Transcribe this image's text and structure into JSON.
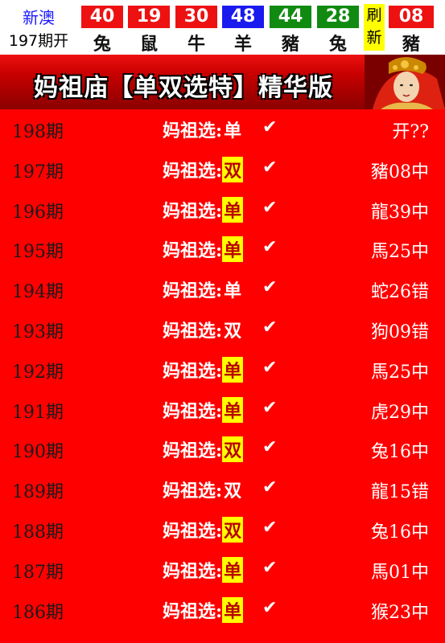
{
  "header": {
    "label_top": "新澳",
    "label_bottom": "197期开",
    "balls": [
      {
        "number": "40",
        "zodiac": "兔",
        "color": "#ee1111"
      },
      {
        "number": "19",
        "zodiac": "鼠",
        "color": "#ee1111"
      },
      {
        "number": "30",
        "zodiac": "牛",
        "color": "#ee1111"
      },
      {
        "number": "48",
        "zodiac": "羊",
        "color": "#1a1aee"
      },
      {
        "number": "44",
        "zodiac": "豬",
        "color": "#118a11"
      },
      {
        "number": "28",
        "zodiac": "兔",
        "color": "#118a11"
      }
    ],
    "refresh_chars": [
      "刷",
      "新"
    ],
    "special": {
      "number": "08",
      "zodiac": "豬",
      "color": "#ee1111"
    }
  },
  "banner": {
    "title": "妈祖庙【单双选特】精华版"
  },
  "rows": [
    {
      "period": "198期",
      "label": "妈祖选:",
      "value": "单",
      "highlight": false,
      "check": "✔",
      "result": "开??"
    },
    {
      "period": "197期",
      "label": "妈祖选:",
      "value": "双",
      "highlight": true,
      "check": "✔",
      "result": "豬08中"
    },
    {
      "period": "196期",
      "label": "妈祖选:",
      "value": "单",
      "highlight": true,
      "check": "✔",
      "result": "龍39中"
    },
    {
      "period": "195期",
      "label": "妈祖选:",
      "value": "单",
      "highlight": true,
      "check": "✔",
      "result": "馬25中"
    },
    {
      "period": "194期",
      "label": "妈祖选:",
      "value": "单",
      "highlight": false,
      "check": "✔",
      "result": "蛇26错"
    },
    {
      "period": "193期",
      "label": "妈祖选:",
      "value": "双",
      "highlight": false,
      "check": "✔",
      "result": "狗09错"
    },
    {
      "period": "192期",
      "label": "妈祖选:",
      "value": "单",
      "highlight": true,
      "check": "✔",
      "result": "馬25中"
    },
    {
      "period": "191期",
      "label": "妈祖选:",
      "value": "单",
      "highlight": true,
      "check": "✔",
      "result": "虎29中"
    },
    {
      "period": "190期",
      "label": "妈祖选:",
      "value": "双",
      "highlight": true,
      "check": "✔",
      "result": "兔16中"
    },
    {
      "period": "189期",
      "label": "妈祖选:",
      "value": "双",
      "highlight": false,
      "check": "✔",
      "result": "龍15错"
    },
    {
      "period": "188期",
      "label": "妈祖选:",
      "value": "双",
      "highlight": true,
      "check": "✔",
      "result": "兔16中"
    },
    {
      "period": "187期",
      "label": "妈祖选:",
      "value": "单",
      "highlight": true,
      "check": "✔",
      "result": "馬01中"
    },
    {
      "period": "186期",
      "label": "妈祖选:",
      "value": "单",
      "highlight": true,
      "check": "✔",
      "result": "猴23中"
    }
  ]
}
